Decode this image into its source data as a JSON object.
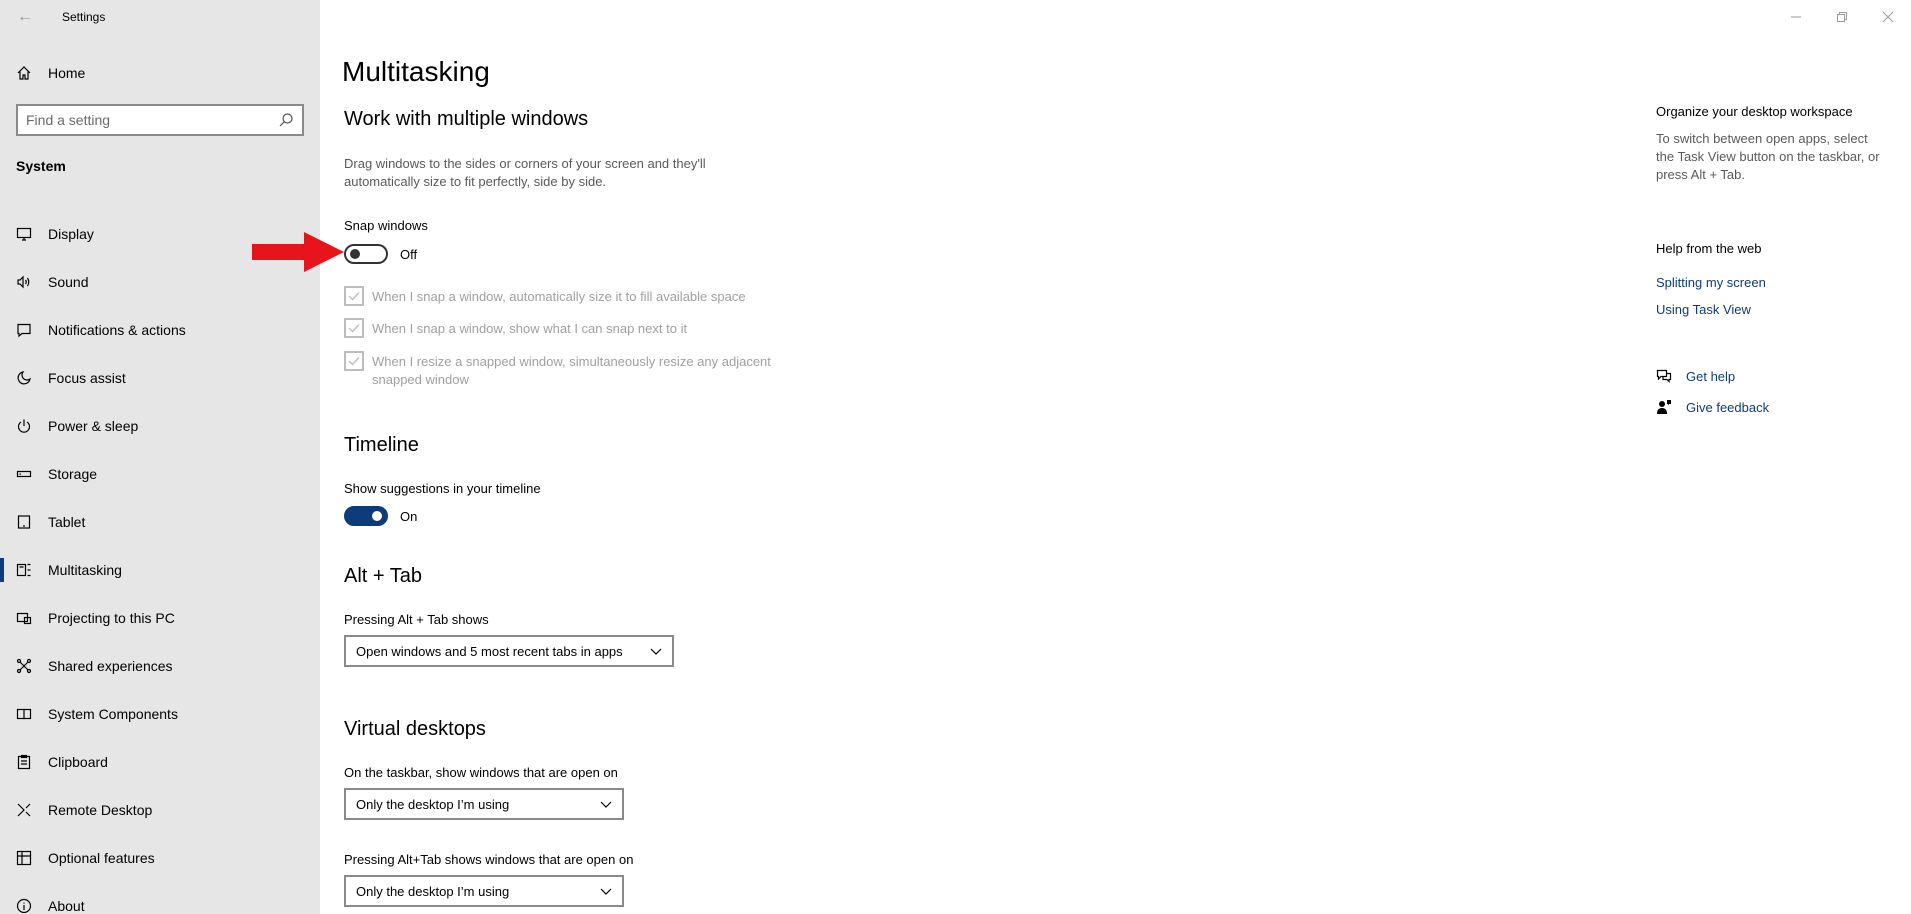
{
  "window": {
    "app_title": "Settings",
    "back_glyph": "←"
  },
  "sidebar": {
    "home_label": "Home",
    "search_placeholder": "Find a setting",
    "section": "System",
    "items": [
      {
        "label": "Display",
        "icon": "monitor-icon"
      },
      {
        "label": "Sound",
        "icon": "speaker-icon"
      },
      {
        "label": "Notifications & actions",
        "icon": "notification-icon"
      },
      {
        "label": "Focus assist",
        "icon": "moon-icon"
      },
      {
        "label": "Power & sleep",
        "icon": "power-icon"
      },
      {
        "label": "Storage",
        "icon": "storage-icon"
      },
      {
        "label": "Tablet",
        "icon": "tablet-icon"
      },
      {
        "label": "Multitasking",
        "icon": "multitasking-icon",
        "active": true
      },
      {
        "label": "Projecting to this PC",
        "icon": "projecting-icon"
      },
      {
        "label": "Shared experiences",
        "icon": "shared-icon"
      },
      {
        "label": "System Components",
        "icon": "components-icon"
      },
      {
        "label": "Clipboard",
        "icon": "clipboard-icon"
      },
      {
        "label": "Remote Desktop",
        "icon": "remote-icon"
      },
      {
        "label": "Optional features",
        "icon": "optional-features-icon"
      },
      {
        "label": "About",
        "icon": "info-icon"
      }
    ]
  },
  "main": {
    "title": "Multitasking",
    "multiple_windows": {
      "heading": "Work with multiple windows",
      "description": "Drag windows to the sides or corners of your screen and they'll automatically size to fit perfectly, side by side.",
      "snap_label": "Snap windows",
      "snap_state": "Off",
      "snap_on": false,
      "options": [
        "When I snap a window, automatically size it to fill available space",
        "When I snap a window, show what I can snap next to it",
        "When I resize a snapped window, simultaneously resize any adjacent snapped window"
      ]
    },
    "timeline": {
      "heading": "Timeline",
      "label": "Show suggestions in your timeline",
      "state": "On",
      "on": true
    },
    "alt_tab": {
      "heading": "Alt + Tab",
      "label": "Pressing Alt + Tab shows",
      "selected": "Open windows and 5 most recent tabs in apps"
    },
    "virtual_desktops": {
      "heading": "Virtual desktops",
      "taskbar_label": "On the taskbar, show windows that are open on",
      "taskbar_selected": "Only the desktop I’m using",
      "alttab_label": "Pressing Alt+Tab shows windows that are open on",
      "alttab_selected": "Only the desktop I’m using"
    }
  },
  "right_panel": {
    "organize_heading": "Organize your desktop workspace",
    "organize_text": "To switch between open apps, select the Task View button on the taskbar, or press Alt + Tab.",
    "help_heading": "Help from the web",
    "links": [
      "Splitting my screen",
      "Using Task View"
    ],
    "get_help": "Get help",
    "give_feedback": "Give feedback"
  },
  "colors": {
    "accent": "#0e3b79",
    "sidebar_bg": "#e6e6e6",
    "annotation_arrow": "#e8141b"
  }
}
